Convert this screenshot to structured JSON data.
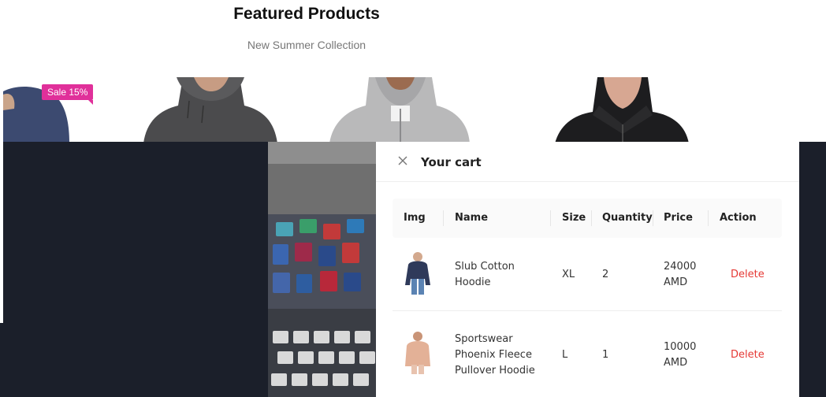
{
  "featured": {
    "title": "Featured Products",
    "subtitle": "New Summer Collection",
    "sale_badge": "Sale 15%"
  },
  "cart": {
    "title": "Your cart",
    "columns": [
      "Img",
      "Name",
      "Size",
      "Quantity",
      "Price",
      "Action"
    ],
    "items": [
      {
        "name": "Slub Cotton Hoodie",
        "size": "XL",
        "quantity": "2",
        "price": "24000 AMD",
        "action": "Delete"
      },
      {
        "name": "Sportswear Phoenix Fleece Pullover Hoodie",
        "size": "L",
        "quantity": "1",
        "price": "10000 AMD",
        "action": "Delete"
      }
    ]
  },
  "colors": {
    "sale_badge": "#e0309a",
    "overlay": "#1b1f2a",
    "delete": "#e53935"
  }
}
